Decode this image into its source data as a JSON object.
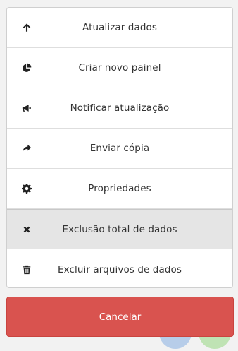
{
  "action_sheet": {
    "items": [
      {
        "label": "Atualizar dados",
        "icon": "arrow-up-icon"
      },
      {
        "label": "Criar novo painel",
        "icon": "pie-chart-icon"
      },
      {
        "label": "Notificar atualização",
        "icon": "bullhorn-icon"
      },
      {
        "label": "Enviar cópia",
        "icon": "share-icon"
      },
      {
        "label": "Propriedades",
        "icon": "gear-icon"
      },
      {
        "label": "Exclusão total de dados",
        "icon": "close-icon",
        "state": "highlighted"
      },
      {
        "label": "Excluir arquivos de dados",
        "icon": "trash-icon"
      }
    ]
  },
  "cancel": {
    "label": "Cancelar"
  },
  "colors": {
    "cancel_bg": "#d9534f",
    "highlight_bg": "#e5e5e5"
  }
}
